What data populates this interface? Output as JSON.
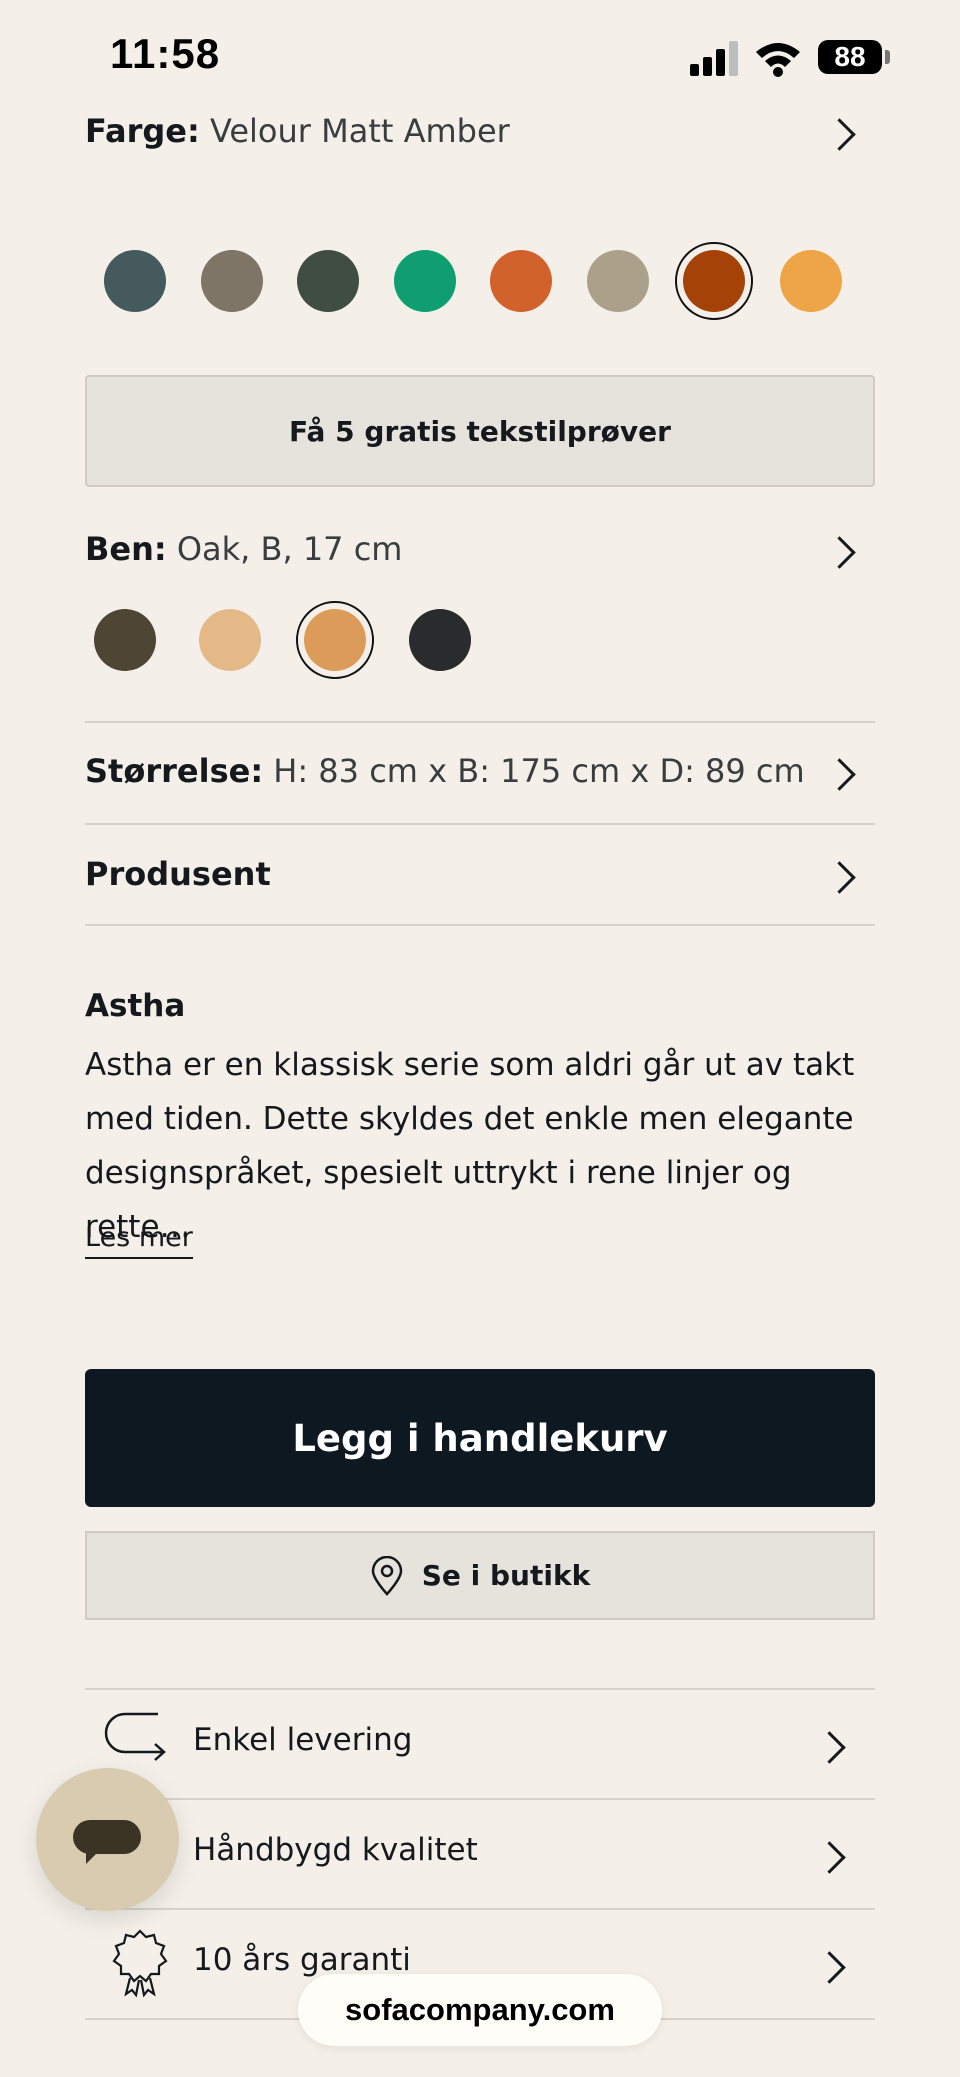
{
  "status_bar": {
    "time": "11:58",
    "battery": "88"
  },
  "color": {
    "label": "Farge:",
    "value": "Velour Matt Amber",
    "swatches": [
      "#445a5c",
      "#7e7566",
      "#3f4d43",
      "#0f9e70",
      "#d2622b",
      "#aba18b",
      "#a54208",
      "#eda548"
    ],
    "selected_index": 6
  },
  "samples_button": "Få 5 gratis tekstilprøver",
  "legs": {
    "label": "Ben:",
    "value": "Oak, B, 17 cm",
    "swatches": [
      "#4e4632",
      "#e3b988",
      "#dd9b5a",
      "#2a2b2d"
    ],
    "selected_index": 2
  },
  "size": {
    "label": "Størrelse:",
    "value": "H: 83 cm x B: 175 cm x D: 89 cm"
  },
  "manufacturer": {
    "label": "Produsent"
  },
  "description": {
    "title": "Astha",
    "text": "Astha er en klassisk serie som aldri går ut av takt med tiden. Dette skyldes det enkle men elegante designspråket, spesielt uttrykt i rene linjer og rette…",
    "read_more": "Les mer"
  },
  "add_to_cart": "Legg i handlekurv",
  "see_in_store": "Se i butikk",
  "features": [
    {
      "label": "Enkel levering",
      "icon": "delivery-arrow-icon"
    },
    {
      "label": "Håndbygd kvalitet",
      "icon": "chat-icon"
    },
    {
      "label": "10 års garanti",
      "icon": "badge-icon"
    }
  ],
  "url": "sofacompany.com"
}
